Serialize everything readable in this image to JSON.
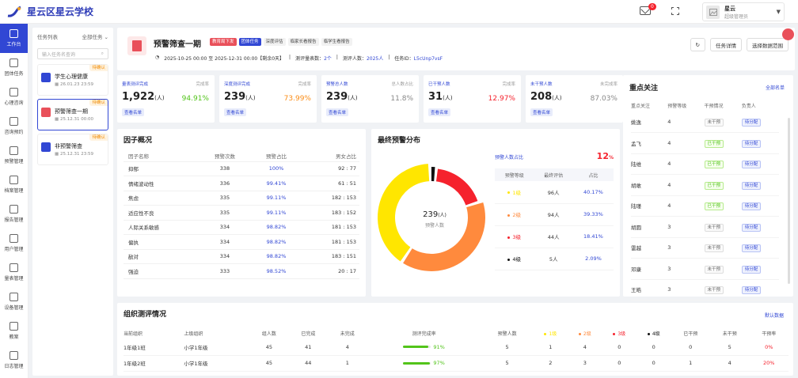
{
  "app": {
    "title": "星云区星云学校",
    "notif_count": "0",
    "user_name": "星云",
    "user_role": "超级管理员"
  },
  "nav": [
    {
      "label": "工作台",
      "icon": "grid-icon"
    },
    {
      "label": "团体任务",
      "icon": "group-icon"
    },
    {
      "label": "心理咨询",
      "icon": "chat-icon"
    },
    {
      "label": "咨询预约",
      "icon": "calendar-icon"
    },
    {
      "label": "预警管理",
      "icon": "bell-icon"
    },
    {
      "label": "档案管理",
      "icon": "folder-icon"
    },
    {
      "label": "报告管理",
      "icon": "report-icon"
    },
    {
      "label": "用户管理",
      "icon": "users-icon"
    },
    {
      "label": "量表管理",
      "icon": "scale-icon"
    },
    {
      "label": "设备管理",
      "icon": "device-icon"
    },
    {
      "label": "教案",
      "icon": "book-icon"
    },
    {
      "label": "日志管理",
      "icon": "log-icon"
    }
  ],
  "tasklist": {
    "title": "任务列表",
    "filter": "全部任务",
    "search_placeholder": "输入任务名查询",
    "items": [
      {
        "name": "学生心理健康",
        "date": "26.01.23 23:59",
        "tag": "待确认"
      },
      {
        "name": "预警筛查一期",
        "date": "25.12.31 00:00",
        "tag": "待确认"
      },
      {
        "name": "非预警筛查",
        "date": "25.12.31 23:59",
        "tag": "待确认"
      }
    ]
  },
  "header": {
    "name": "预警筛查一期",
    "chips": [
      "教育局下发",
      "团体任务",
      "深度评估",
      "临家长看报告",
      "临学生看报告"
    ],
    "date_range": "2025-10-25 00:00 至 2025-12-31 00:00【剩余0天】",
    "scale_label": "测评量表数：",
    "scale_count": "2个",
    "people_label": "测评人数：",
    "people_count": "2025人",
    "id_label": "任务ID：",
    "id": "L5cUnp7vsF",
    "buttons": {
      "refresh": "↻",
      "detail": "任务详情",
      "select": "选择数据范围"
    }
  },
  "stats": [
    {
      "label": "量表测评完成",
      "rlabel": "完成率",
      "value": "1,922",
      "unit": "(人)",
      "pct": "94.91%",
      "pct_color": "#52c41a",
      "btn": "查看名单"
    },
    {
      "label": "深度测评完成",
      "rlabel": "完成率",
      "value": "239",
      "unit": "(人)",
      "pct": "73.99%",
      "pct_color": "#fa8c16",
      "btn": "查看名单"
    },
    {
      "label": "预警总人数",
      "rlabel": "总人数占比",
      "value": "239",
      "unit": "(人)",
      "pct": "11.8%",
      "pct_color": "#888",
      "btn": "查看名单"
    },
    {
      "label": "已干预人数",
      "rlabel": "完成率",
      "value": "31",
      "unit": "(人)",
      "pct": "12.97%",
      "pct_color": "#f5222d",
      "btn": "查看名单"
    },
    {
      "label": "未干预人数",
      "rlabel": "未完成率",
      "value": "208",
      "unit": "(人)",
      "pct": "87.03%",
      "pct_color": "#888",
      "btn": "查看名单"
    }
  ],
  "factor": {
    "title": "因子概况",
    "headers": [
      "因子名称",
      "预警次数",
      "预警占比",
      "男女占比"
    ],
    "rows": [
      [
        "抑郁",
        "338",
        "100%",
        "92 : 77"
      ],
      [
        "情绪波动性",
        "336",
        "99.41%",
        "61 : 51"
      ],
      [
        "焦虑",
        "335",
        "99.11%",
        "182 : 153"
      ],
      [
        "适应性不良",
        "335",
        "99.11%",
        "183 : 152"
      ],
      [
        "人际关系敏感",
        "334",
        "98.82%",
        "181 : 153"
      ],
      [
        "偏执",
        "334",
        "98.82%",
        "181 : 153"
      ],
      [
        "敌对",
        "334",
        "98.82%",
        "183 : 151"
      ],
      [
        "强迫",
        "333",
        "98.52%",
        "20 : 17"
      ]
    ]
  },
  "dist": {
    "title": "最终预警分布",
    "center_value": "239",
    "center_unit": "(人)",
    "center_label": "预警人数",
    "ratio_label": "预警人数占比",
    "ratio": "12",
    "headers": [
      "预警等级",
      "最终评估",
      "占比"
    ],
    "rows": [
      {
        "level": "1级",
        "count": "96人",
        "pct": "40.17%",
        "color": "#ffe600"
      },
      {
        "level": "2级",
        "count": "94人",
        "pct": "39.33%",
        "color": "#ff8a3d"
      },
      {
        "level": "3级",
        "count": "44人",
        "pct": "18.41%",
        "color": "#f5222d"
      },
      {
        "level": "4级",
        "count": "5人",
        "pct": "2.09%",
        "color": "#111111"
      }
    ],
    "values": [
      96,
      94,
      44,
      5
    ]
  },
  "focus": {
    "title": "重点关注",
    "more": "全部名单",
    "headers": [
      "重点关注",
      "预警等级",
      "干预情况",
      "负责人"
    ],
    "rows": [
      [
        "姚逸",
        "4",
        "未干预",
        "待分配"
      ],
      [
        "孟飞",
        "4",
        "已干预",
        "待分配"
      ],
      [
        "陆维",
        "4",
        "已干预",
        "待分配"
      ],
      [
        "胡敢",
        "4",
        "已干预",
        "待分配"
      ],
      [
        "陆瑾",
        "4",
        "已干预",
        "待分配"
      ],
      [
        "胡圆",
        "3",
        "未干预",
        "待分配"
      ],
      [
        "雷越",
        "3",
        "未干预",
        "待分配"
      ],
      [
        "邓康",
        "3",
        "未干预",
        "待分配"
      ],
      [
        "王皓",
        "3",
        "未干预",
        "待分配"
      ]
    ]
  },
  "org": {
    "title": "组织测评情况",
    "more": "默认数据",
    "headers": [
      "当前组织",
      "上级组织",
      "组人数",
      "已完成",
      "未完成",
      "测评完成率",
      "预警人数",
      "1级",
      "2级",
      "3级",
      "4级",
      "已干预",
      "未干预",
      "干预率"
    ],
    "rows": [
      {
        "cells": [
          "1年级1班",
          "小学1年级",
          "45",
          "41",
          "4",
          "91%",
          "5",
          "1",
          "4",
          "0",
          "0",
          "0",
          "5",
          "0%"
        ],
        "fill": 0.91
      },
      {
        "cells": [
          "1年级2班",
          "小学1年级",
          "45",
          "44",
          "1",
          "97%",
          "5",
          "2",
          "3",
          "0",
          "0",
          "1",
          "4",
          "20%"
        ],
        "fill": 0.97
      }
    ]
  }
}
